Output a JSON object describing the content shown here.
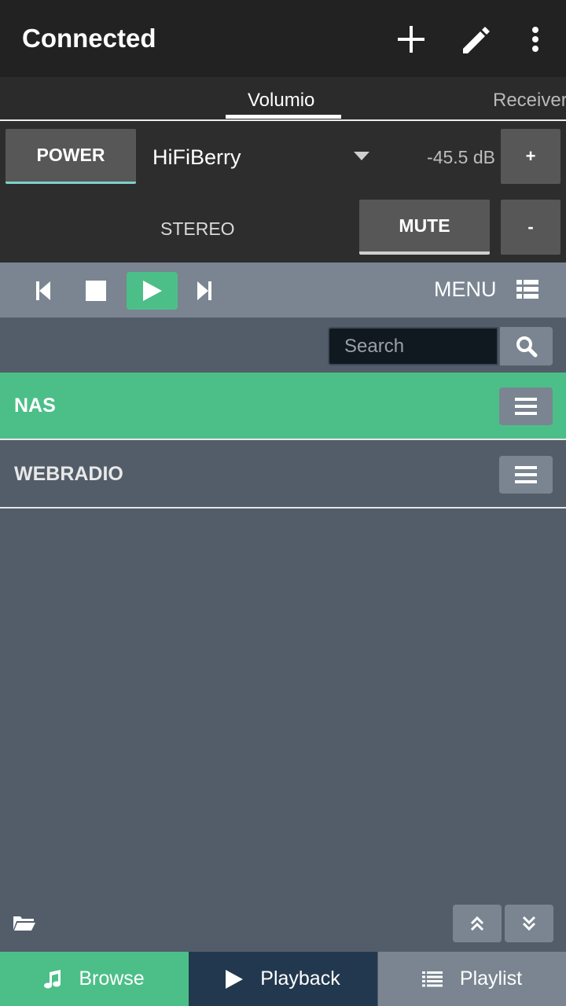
{
  "appbar": {
    "title": "Connected",
    "actions": [
      "plus-icon",
      "pencil-icon",
      "more-vertical-icon"
    ]
  },
  "tabs": [
    {
      "label": "Volumio",
      "selected": true
    },
    {
      "label": "Receiver",
      "selected": false
    }
  ],
  "receiver": {
    "power_label": "POWER",
    "source": "HiFiBerry",
    "volume_db": "-45.5 dB",
    "plus_label": "+",
    "minus_label": "-",
    "mode_label": "STEREO",
    "mute_label": "MUTE"
  },
  "transport": {
    "menu_label": "MENU",
    "icons": [
      "skip-previous-icon",
      "stop-icon",
      "play-icon",
      "skip-next-icon",
      "list-icon"
    ]
  },
  "search": {
    "placeholder": "Search"
  },
  "list": [
    {
      "label": "NAS",
      "selected": true
    },
    {
      "label": "WEBRADIO",
      "selected": false
    }
  ],
  "bottom_nav": {
    "browse": "Browse",
    "playback": "Playback",
    "playlist": "Playlist"
  },
  "colors": {
    "accent_green": "#4cbf88",
    "appbar": "#222222",
    "panel": "#525d69",
    "control_gray": "#7a8591",
    "playback_tab": "#22384e"
  }
}
